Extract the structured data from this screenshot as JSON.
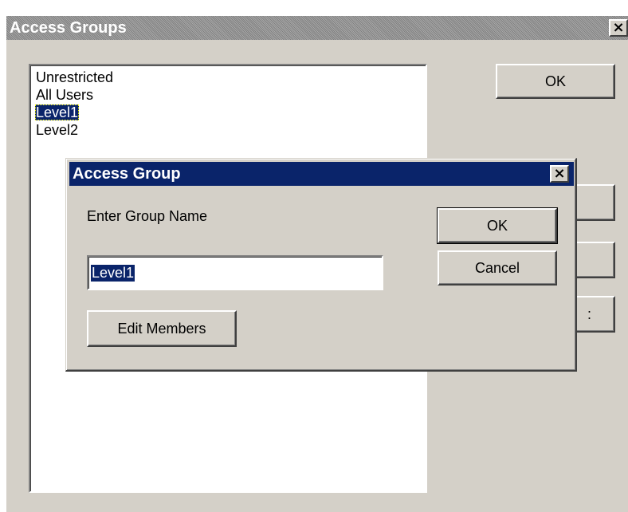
{
  "outer_dialog": {
    "title": "Access Groups",
    "close_glyph": "×",
    "list_items": [
      {
        "label": "Unrestricted"
      },
      {
        "label": "All Users"
      },
      {
        "label": "Level1",
        "selected": true
      },
      {
        "label": "Level2"
      }
    ],
    "ok_label": "OK",
    "obscured_button_partial_label": ":"
  },
  "inner_dialog": {
    "title": "Access Group",
    "close_glyph": "×",
    "prompt_label": "Enter Group Name",
    "group_name_value": "Level1",
    "ok_label": "OK",
    "cancel_label": "Cancel",
    "edit_members_label": "Edit Members"
  },
  "colors": {
    "dialog_face": "#d4d0c8",
    "active_title": "#0a246a",
    "inactive_title": "#808080",
    "selection": "#0a246a"
  }
}
